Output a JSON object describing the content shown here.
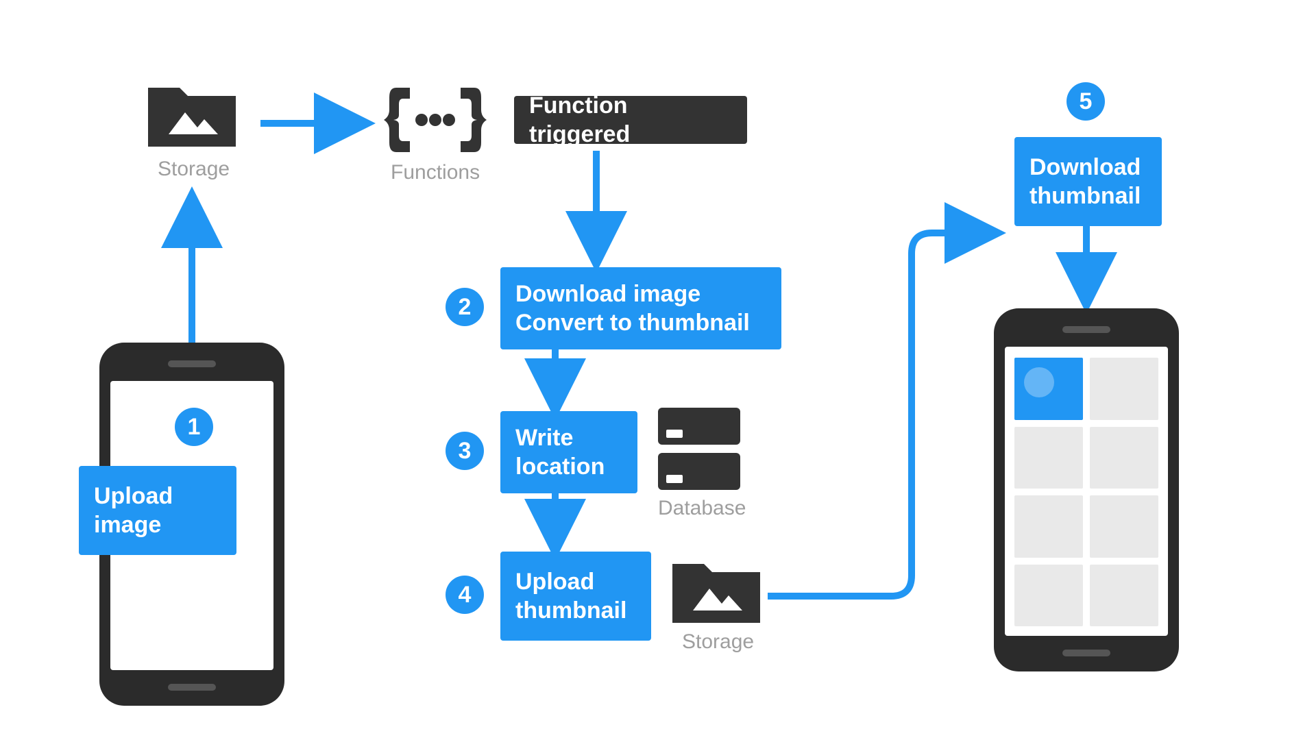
{
  "labels": {
    "storage_top": "Storage",
    "functions": "Functions",
    "function_triggered": "Function triggered",
    "download_convert": "Download image\nConvert to thumbnail",
    "write_location": "Write\nlocation",
    "database": "Database",
    "upload_thumb": "Upload\nthumbnail",
    "storage_bottom": "Storage",
    "upload_image": "Upload\nimage",
    "download_thumb": "Download\nthumbnail"
  },
  "badges": {
    "b1": "1",
    "b2": "2",
    "b3": "3",
    "b4": "4",
    "b5": "5"
  },
  "colors": {
    "blue": "#2196f3",
    "dark": "#333333",
    "gray": "#9e9e9e"
  }
}
